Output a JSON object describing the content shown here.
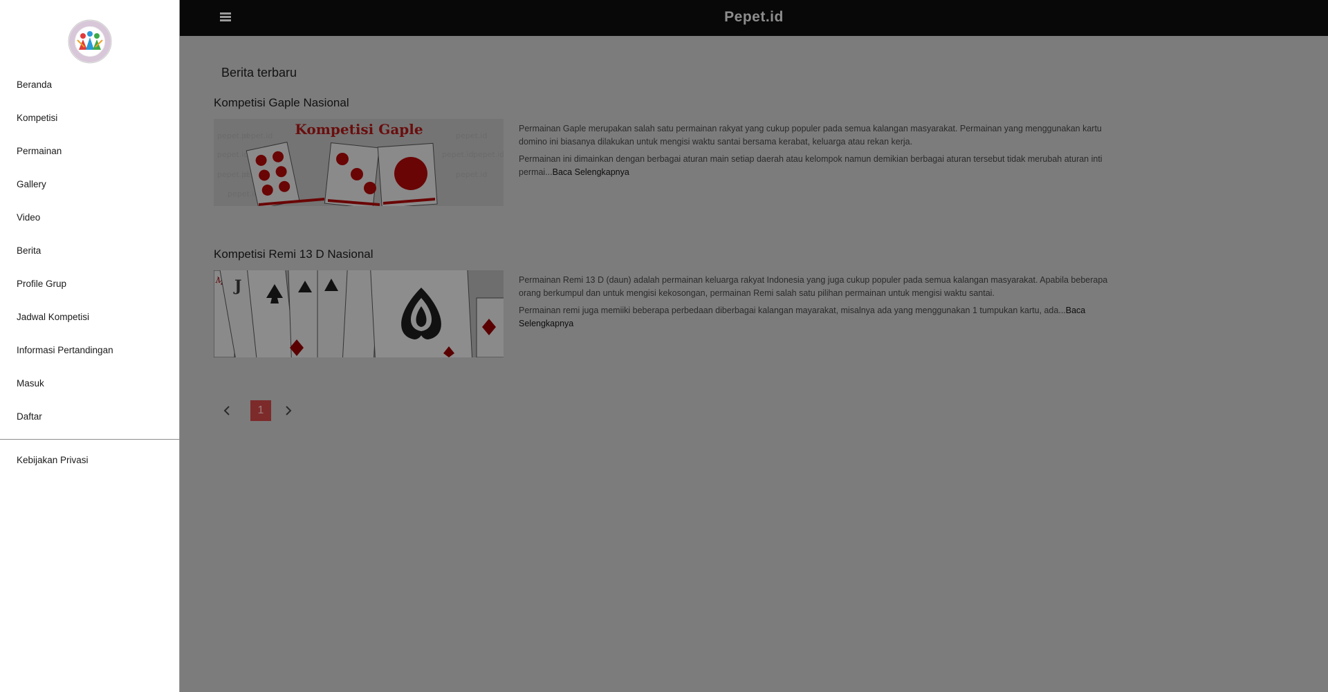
{
  "header": {
    "site_title": "Pepet.id",
    "menu_icon": "hamburger-menu-icon"
  },
  "sidebar": {
    "logo_icon": "organization-logo",
    "items": [
      {
        "label": "Beranda"
      },
      {
        "label": "Kompetisi"
      },
      {
        "label": "Permainan"
      },
      {
        "label": "Gallery"
      },
      {
        "label": "Video"
      },
      {
        "label": "Berita"
      },
      {
        "label": "Profile Grup"
      },
      {
        "label": "Jadwal Kompetisi"
      },
      {
        "label": "Informasi Pertandingan"
      },
      {
        "label": "Masuk"
      },
      {
        "label": "Daftar"
      }
    ],
    "footer_items": [
      {
        "label": "Kebijakan Privasi"
      }
    ]
  },
  "main": {
    "section_title": "Berita terbaru",
    "articles": [
      {
        "title": "Kompetisi Gaple Nasional",
        "image_caption": "Kompetisi Gaple",
        "image_watermark": "pepet.id",
        "paragraph_1": "Permainan Gaple merupakan salah satu permainan rakyat yang cukup populer pada semua kalangan masyarakat. Permainan yang menggunakan kartu domino ini biasanya dilakukan untuk mengisi waktu santai bersama kerabat, keluarga atau rekan kerja.",
        "paragraph_2": "Permainan ini dimainkan dengan berbagai aturan main setiap daerah atau kelompok namun demikian berbagai aturan tersebut tidak merubah aturan inti permai...",
        "read_more": "Baca Selengkapnya"
      },
      {
        "title": "Kompetisi Remi 13 D Nasional",
        "paragraph_1": "Permainan Remi 13 D (daun) adalah permainan keluarga rakyat Indonesia yang juga cukup populer pada semua kalangan masyarakat. Apabila beberapa orang berkumpul dan untuk mengisi kekosongan, permainan Remi salah satu pilihan permainan untuk mengisi waktu santai.",
        "paragraph_2": "Permainan remi juga memiiki beberapa perbedaan diberbagai kalangan mayarakat, misalnya ada yang menggunakan 1 tumpukan kartu, ada...",
        "read_more": "Baca Selengkapnya"
      }
    ],
    "pagination": {
      "current_page": "1",
      "prev_icon": "chevron-left-icon",
      "next_icon": "chevron-right-icon"
    }
  },
  "colors": {
    "overlay": "#7c7c7c",
    "topbar": "#080808",
    "active_page": "#7d2a2a"
  }
}
